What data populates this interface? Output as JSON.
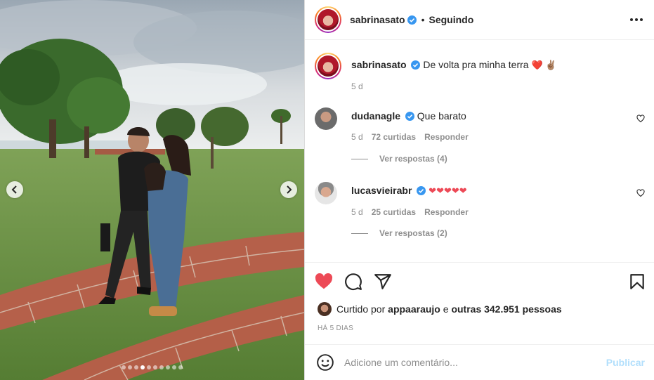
{
  "header": {
    "username": "sabrinasato",
    "separator": "•",
    "follow_status": "Seguindo"
  },
  "caption": {
    "username": "sabrinasato",
    "text": "De volta pra minha terra",
    "emojis": "❤️ ✌🏽",
    "age": "5 d"
  },
  "comments": [
    {
      "username": "dudanagle",
      "text": "Que barato",
      "age": "5 d",
      "likes": "72 curtidas",
      "reply_label": "Responder",
      "view_replies": "Ver respostas (4)"
    },
    {
      "username": "lucasvieirabr",
      "text": "❤❤❤❤❤",
      "age": "5 d",
      "likes": "25 curtidas",
      "reply_label": "Responder",
      "view_replies": "Ver respostas (2)"
    }
  ],
  "likes": {
    "prefix": "Curtido por",
    "user": "appaaraujo",
    "middle": "e",
    "others": "outras 342.951 pessoas"
  },
  "timestamp": "HÁ 5 DIAS",
  "add_comment": {
    "placeholder": "Adicione um comentário...",
    "publish_label": "Publicar"
  },
  "carousel": {
    "total_slides": 10,
    "active_slide": 3
  },
  "icons": {
    "more": "more-options-icon",
    "like": "heart-filled-icon",
    "comment": "comment-icon",
    "share": "share-icon",
    "save": "bookmark-icon",
    "emoji": "emoji-icon",
    "verified": "verified-badge-icon"
  },
  "colors": {
    "like_red": "#ed4956",
    "verified_blue": "#3897f0",
    "publish_disabled": "#b2dffc",
    "muted_text": "#8e8e8e"
  }
}
